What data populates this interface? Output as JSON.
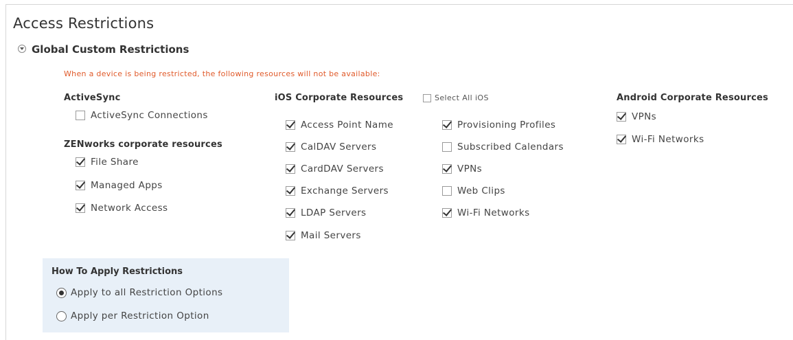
{
  "page": {
    "title": "Access Restrictions"
  },
  "section": {
    "title": "Global Custom Restrictions",
    "expanded": true
  },
  "warning": "When a device is being restricted, the following resources will not be available:",
  "activesync": {
    "title": "ActiveSync",
    "items": [
      {
        "label": "ActiveSync Connections",
        "checked": false
      }
    ]
  },
  "zenworks": {
    "title": "ZENworks corporate resources",
    "items": [
      {
        "label": "File Share",
        "checked": true
      },
      {
        "label": "Managed Apps",
        "checked": true
      },
      {
        "label": "Network Access",
        "checked": true
      }
    ]
  },
  "ios": {
    "title": "iOS Corporate Resources",
    "select_all_label": "Select All iOS",
    "select_all_checked": false,
    "col1": [
      {
        "label": "Access Point Name",
        "checked": true
      },
      {
        "label": "CalDAV Servers",
        "checked": true
      },
      {
        "label": "CardDAV Servers",
        "checked": true
      },
      {
        "label": "Exchange Servers",
        "checked": true
      },
      {
        "label": "LDAP Servers",
        "checked": true
      },
      {
        "label": "Mail Servers",
        "checked": true
      }
    ],
    "col2": [
      {
        "label": "Provisioning Profiles",
        "checked": true
      },
      {
        "label": "Subscribed Calendars",
        "checked": false
      },
      {
        "label": "VPNs",
        "checked": true
      },
      {
        "label": "Web Clips",
        "checked": false
      },
      {
        "label": "Wi-Fi Networks",
        "checked": true
      }
    ]
  },
  "android": {
    "title": "Android Corporate Resources",
    "items": [
      {
        "label": "VPNs",
        "checked": true
      },
      {
        "label": "Wi-Fi Networks",
        "checked": true
      }
    ]
  },
  "apply": {
    "title": "How To Apply Restrictions",
    "options": [
      {
        "label": "Apply to all Restriction Options",
        "selected": true
      },
      {
        "label": "Apply per Restriction Option",
        "selected": false
      }
    ]
  }
}
